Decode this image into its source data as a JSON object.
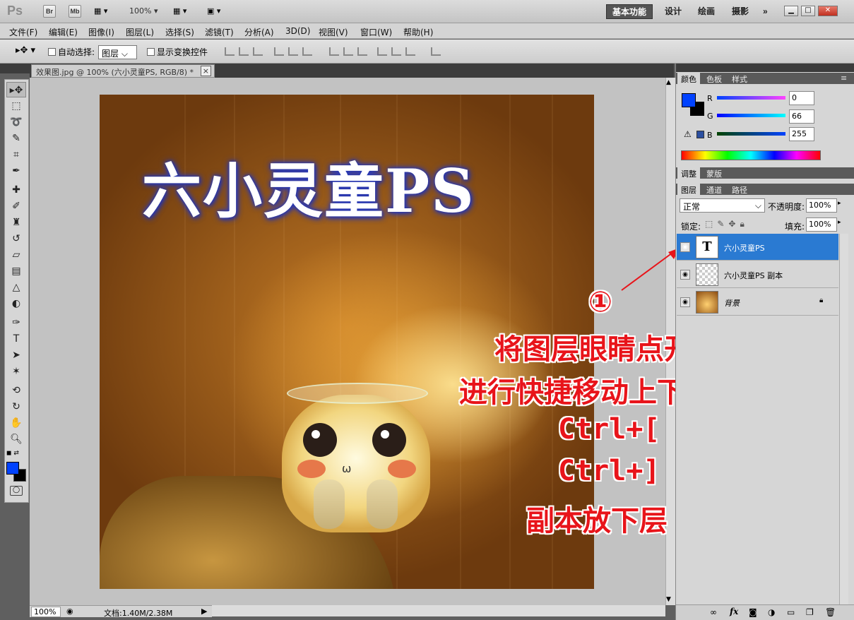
{
  "app": {
    "logo": "Ps",
    "bridge_label": "Br",
    "minibridge_label": "Mb",
    "zoom": "100%",
    "workspaces": [
      "基本功能",
      "设计",
      "绘画",
      "摄影"
    ],
    "more": "»"
  },
  "menu": [
    "文件(F)",
    "编辑(E)",
    "图像(I)",
    "图层(L)",
    "选择(S)",
    "滤镜(T)",
    "分析(A)",
    "3D(D)",
    "视图(V)",
    "窗口(W)",
    "帮助(H)"
  ],
  "options": {
    "auto_select_label": "自动选择:",
    "auto_select_value": "图层",
    "transform_label": "显示变换控件"
  },
  "document": {
    "tab_title": "效果图.jpg @ 100% (六小灵童PS, RGB/8) *",
    "close": "×",
    "canvas_text": "六小灵童PS",
    "mouth": "ω",
    "status_zoom": "100%",
    "status_doc": "文档:1.40M/2.38M"
  },
  "annotation": {
    "number": "①",
    "line1": "将图层眼睛点开",
    "line2": "进行快捷移动上下层",
    "line3": "Ctrl+[",
    "line4": "Ctrl+]",
    "line5": "副本放下层"
  },
  "color_panel": {
    "tabs": [
      "颜色",
      "色板",
      "样式"
    ],
    "r_label": "R",
    "g_label": "G",
    "b_label": "B",
    "r": "0",
    "g": "66",
    "b": "255",
    "fg": "#0042ff",
    "warning": "⚠"
  },
  "adjust_panel": {
    "tabs": [
      "调整",
      "蒙版"
    ]
  },
  "layers_panel": {
    "tabs": [
      "图层",
      "通道",
      "路径"
    ],
    "blend_mode": "正常",
    "opacity_label": "不透明度:",
    "opacity": "100%",
    "lock_label": "锁定:",
    "fill_label": "填充:",
    "fill": "100%",
    "layers": [
      {
        "name": "六小灵童PS",
        "type": "text",
        "selected": true,
        "thumb_glyph": "T"
      },
      {
        "name": "六小灵童PS 副本",
        "type": "raster",
        "selected": false
      },
      {
        "name": "背景",
        "type": "background",
        "selected": false,
        "locked": true
      }
    ],
    "footer_icons": [
      "link-icon",
      "fx-icon",
      "mask-icon",
      "adjustment-icon",
      "group-icon",
      "new-layer-icon",
      "trash-icon"
    ],
    "fx_label": "fx"
  }
}
